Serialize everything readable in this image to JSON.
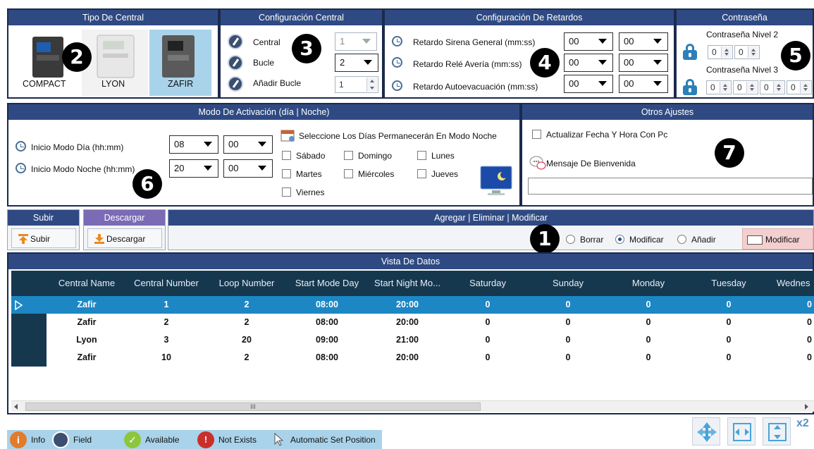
{
  "tipo_central": {
    "header": "Tipo De Central",
    "devices": [
      "COMPACT",
      "LYON",
      "ZAFIR"
    ],
    "selected": "ZAFIR"
  },
  "config_central": {
    "header": "Configuración Central",
    "central_label": "Central",
    "central_value": "1",
    "bucle_label": "Bucle",
    "bucle_value": "2",
    "anadir_label": "Añadir Bucle",
    "anadir_value": "1"
  },
  "retardos": {
    "header": "Configuración De Retardos",
    "rows": [
      {
        "label": "Retardo Sirena General (mm:ss)",
        "mm": "00",
        "ss": "00"
      },
      {
        "label": "Retardo Relé Avería (mm:ss)",
        "mm": "00",
        "ss": "00"
      },
      {
        "label": "Retardo Autoevacuación (mm:ss)",
        "mm": "00",
        "ss": "00"
      }
    ]
  },
  "contrasena": {
    "header": "Contraseña",
    "nivel2_label": "Contraseña Nivel 2",
    "nivel2_values": [
      "0",
      "0"
    ],
    "nivel3_label": "Contraseña Nivel 3",
    "nivel3_values": [
      "0",
      "0",
      "0",
      "0"
    ]
  },
  "modo_activacion": {
    "header": "Modo De Activación (día | Noche)",
    "dia_label": "Inicio Modo Día (hh:mm)",
    "dia_hh": "08",
    "dia_mm": "00",
    "noche_label": "Inicio Modo Noche (hh:mm)",
    "noche_hh": "20",
    "noche_mm": "00",
    "dias_title": "Seleccione Los Días Permanecerán En Modo Noche",
    "days": [
      "Sábado",
      "Domingo",
      "Lunes",
      "Martes",
      "Miércoles",
      "Jueves",
      "Viernes"
    ]
  },
  "otros_ajustes": {
    "header": "Otros Ajustes",
    "actualizar_label": "Actualizar Fecha Y Hora Con Pc",
    "mensaje_label": "Mensaje De Bienvenida",
    "mensaje_value": ""
  },
  "subir": {
    "header": "Subir",
    "button": "Subir"
  },
  "descargar": {
    "header": "Descargar",
    "button": "Descargar"
  },
  "agregar": {
    "header": "Agregar | Eliminar | Modificar",
    "options": [
      "Borrar",
      "Modificar",
      "Añadir"
    ],
    "selected": "Modificar",
    "action_button": "Modificar"
  },
  "vista": {
    "header": "Vista De Datos",
    "columns": [
      "Central Name",
      "Central Number",
      "Loop Number",
      "Start Mode Day",
      "Start Night Mo...",
      "Saturday",
      "Sunday",
      "Monday",
      "Tuesday",
      "Wednes"
    ],
    "rows": [
      [
        "Zafir",
        "1",
        "2",
        "08:00",
        "20:00",
        "0",
        "0",
        "0",
        "0",
        "0"
      ],
      [
        "Zafir",
        "2",
        "2",
        "08:00",
        "20:00",
        "0",
        "0",
        "0",
        "0",
        "0"
      ],
      [
        "Lyon",
        "3",
        "20",
        "09:00",
        "21:00",
        "0",
        "0",
        "0",
        "0",
        "0"
      ],
      [
        "Zafir",
        "10",
        "2",
        "08:00",
        "20:00",
        "0",
        "0",
        "0",
        "0",
        "0"
      ]
    ],
    "scroll_marker": "III"
  },
  "badges": [
    "1",
    "2",
    "3",
    "4",
    "5",
    "6",
    "7"
  ],
  "legend": [
    "Info",
    "Field",
    "Available",
    "Not Exists",
    "Automatic Set Position"
  ],
  "corner_label": "x2",
  "colors": {
    "header_bg": "#2f4a83",
    "border": "#1b2a4d",
    "selected_row": "#1c87c4",
    "grid_header": "#16384f",
    "descargar_bg": "#7b6bb5",
    "modificar_btn": "#f3cfcf"
  }
}
